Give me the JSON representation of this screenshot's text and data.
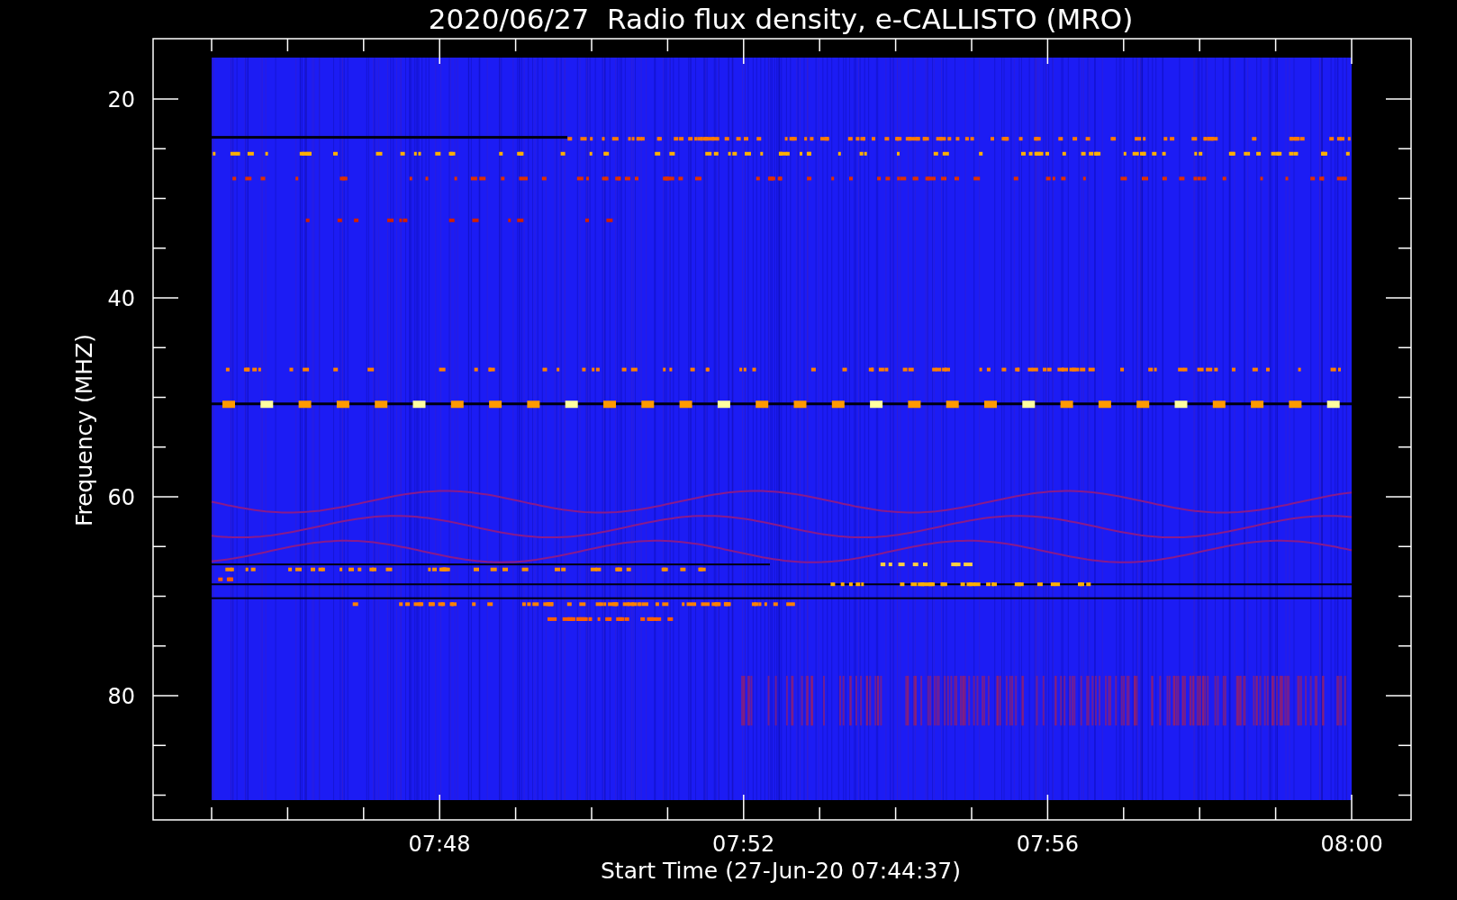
{
  "title": "2020/06/27  Radio flux density, e-CALLISTO (MRO)",
  "plot": {
    "ylabel": "Frequency (MHZ)",
    "xlabel": "Start Time (27-Jun-20 07:44:37)",
    "yticks": [
      "20",
      "40",
      "60",
      "80"
    ],
    "xticks": [
      "07:48",
      "07:52",
      "07:56",
      "08:00"
    ]
  }
}
